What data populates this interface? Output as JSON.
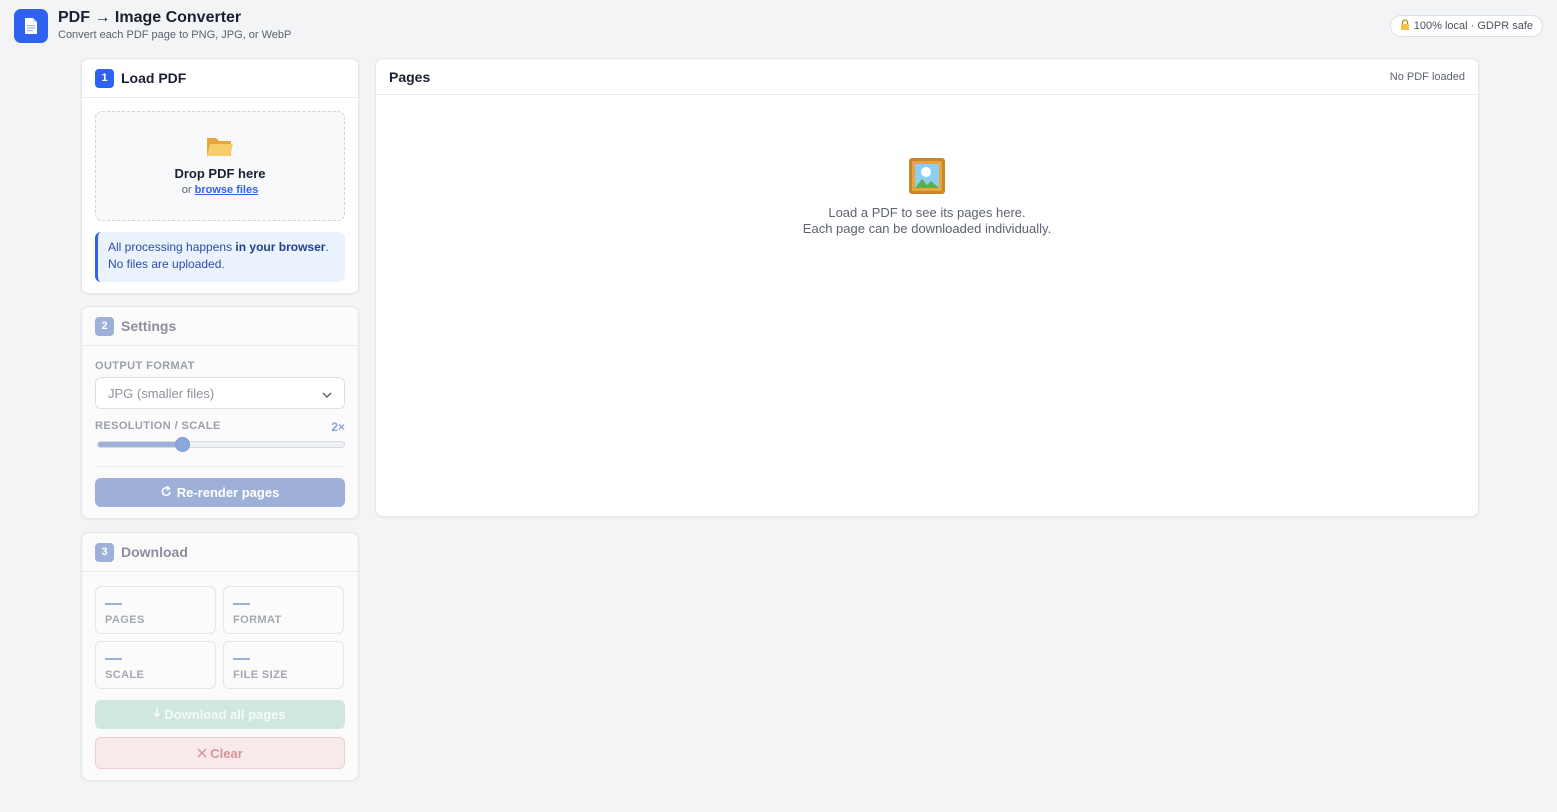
{
  "header": {
    "title": "PDF → Image Converter",
    "subtitle": "Convert each PDF page to PNG, JPG, or WebP",
    "badge": "100% local · GDPR safe",
    "brand_color": "#2f62f0"
  },
  "load_card": {
    "step": "1",
    "title": "Load PDF",
    "drop_title": "Drop PDF here",
    "drop_or": "or",
    "browse_label": "browse files",
    "note_prefix": "All processing happens ",
    "note_bold": "in your browser",
    "note_suffix": ". No files are uploaded."
  },
  "settings_card": {
    "step": "2",
    "title": "Settings",
    "format_label": "OUTPUT FORMAT",
    "format_value": "JPG (smaller files)",
    "scale_label": "RESOLUTION / SCALE",
    "scale_value": "2×",
    "scale_position": 0.34,
    "rerender_label": "Re-render pages"
  },
  "download_card": {
    "step": "3",
    "title": "Download",
    "stats": [
      {
        "label": "PAGES",
        "value": "—"
      },
      {
        "label": "FORMAT",
        "value": "—"
      },
      {
        "label": "SCALE",
        "value": "—"
      },
      {
        "label": "FILE SIZE",
        "value": "—"
      }
    ],
    "download_label": "Download all pages",
    "clear_label": "Clear"
  },
  "pages_panel": {
    "title": "Pages",
    "status": "No PDF loaded",
    "empty_line1": "Load a PDF to see its pages here.",
    "empty_line2": "Each page can be downloaded individually."
  }
}
